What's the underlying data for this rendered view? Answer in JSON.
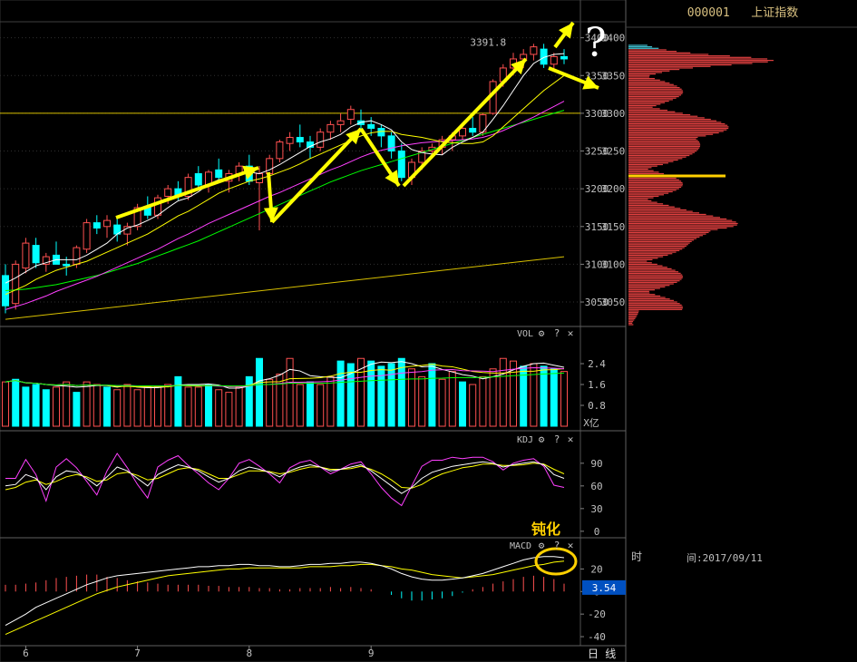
{
  "header": {
    "code": "000001",
    "name": "上证指数"
  },
  "footer": {
    "period": "日 线"
  },
  "time_panel": {
    "label_a": "时",
    "label_b": "间:2017/09/11"
  },
  "annotations": {
    "question": "?",
    "blunt": "钝化"
  },
  "colors": {
    "up": "#ff5050",
    "down": "#00ffff",
    "ma5": "#ffffff",
    "ma10": "#ffff00",
    "ma20": "#ff40ff",
    "ma60": "#00ff00",
    "arrow": "#ffff00",
    "profile": "#e04040"
  },
  "chart_data": [
    {
      "type": "candlestick",
      "name": "price",
      "ylim": [
        3020,
        3420
      ],
      "yticks": [
        3050,
        3100,
        3150,
        3200,
        3250,
        3300,
        3350,
        3400
      ],
      "month_ticks": [
        {
          "label": "6",
          "index": 2
        },
        {
          "label": "7",
          "index": 13
        },
        {
          "label": "8",
          "index": 24
        },
        {
          "label": "9",
          "index": 36
        }
      ],
      "max_label": "3391.8",
      "ohlc": [
        [
          3085,
          3100,
          3035,
          3045
        ],
        [
          3048,
          3105,
          3040,
          3100
        ],
        [
          3095,
          3135,
          3088,
          3128
        ],
        [
          3125,
          3135,
          3095,
          3102
        ],
        [
          3100,
          3115,
          3090,
          3110
        ],
        [
          3112,
          3130,
          3100,
          3100
        ],
        [
          3100,
          3110,
          3085,
          3098
        ],
        [
          3100,
          3125,
          3095,
          3122
        ],
        [
          3120,
          3160,
          3115,
          3155
        ],
        [
          3155,
          3165,
          3140,
          3148
        ],
        [
          3150,
          3165,
          3135,
          3158
        ],
        [
          3152,
          3160,
          3130,
          3140
        ],
        [
          3140,
          3155,
          3125,
          3150
        ],
        [
          3150,
          3180,
          3145,
          3175
        ],
        [
          3175,
          3190,
          3160,
          3165
        ],
        [
          3165,
          3192,
          3160,
          3188
        ],
        [
          3190,
          3205,
          3180,
          3200
        ],
        [
          3200,
          3210,
          3185,
          3190
        ],
        [
          3190,
          3220,
          3185,
          3215
        ],
        [
          3220,
          3230,
          3200,
          3205
        ],
        [
          3205,
          3225,
          3195,
          3222
        ],
        [
          3225,
          3240,
          3210,
          3215
        ],
        [
          3210,
          3225,
          3195,
          3220
        ],
        [
          3220,
          3235,
          3210,
          3230
        ],
        [
          3230,
          3245,
          3205,
          3210
        ],
        [
          3208,
          3230,
          3145,
          3220
        ],
        [
          3220,
          3245,
          3215,
          3240
        ],
        [
          3240,
          3265,
          3235,
          3262
        ],
        [
          3260,
          3275,
          3250,
          3268
        ],
        [
          3268,
          3285,
          3255,
          3262
        ],
        [
          3262,
          3270,
          3240,
          3255
        ],
        [
          3255,
          3280,
          3250,
          3275
        ],
        [
          3275,
          3290,
          3265,
          3285
        ],
        [
          3285,
          3300,
          3275,
          3290
        ],
        [
          3292,
          3310,
          3285,
          3305
        ],
        [
          3290,
          3305,
          3275,
          3285
        ],
        [
          3285,
          3295,
          3270,
          3280
        ],
        [
          3280,
          3285,
          3255,
          3270
        ],
        [
          3270,
          3275,
          3240,
          3250
        ],
        [
          3250,
          3260,
          3210,
          3215
        ],
        [
          3215,
          3240,
          3205,
          3235
        ],
        [
          3235,
          3255,
          3225,
          3250
        ],
        [
          3250,
          3260,
          3240,
          3255
        ],
        [
          3255,
          3270,
          3245,
          3265
        ],
        [
          3265,
          3275,
          3250,
          3270
        ],
        [
          3270,
          3285,
          3265,
          3280
        ],
        [
          3280,
          3295,
          3270,
          3275
        ],
        [
          3275,
          3300,
          3270,
          3298
        ],
        [
          3300,
          3345,
          3298,
          3342
        ],
        [
          3342,
          3365,
          3335,
          3360
        ],
        [
          3360,
          3380,
          3350,
          3372
        ],
        [
          3372,
          3385,
          3360,
          3378
        ],
        [
          3378,
          3392,
          3370,
          3388
        ],
        [
          3385,
          3392,
          3360,
          3365
        ],
        [
          3365,
          3380,
          3355,
          3375
        ],
        [
          3375,
          3385,
          3365,
          3372
        ]
      ],
      "ma5": [
        3075,
        3082,
        3090,
        3098,
        3102,
        3106,
        3106,
        3106,
        3112,
        3120,
        3128,
        3140,
        3148,
        3152,
        3158,
        3165,
        3175,
        3184,
        3188,
        3196,
        3206,
        3212,
        3215,
        3218,
        3222,
        3220,
        3225,
        3232,
        3240,
        3248,
        3256,
        3262,
        3266,
        3272,
        3282,
        3288,
        3290,
        3285,
        3278,
        3262,
        3252,
        3248,
        3246,
        3245,
        3255,
        3262,
        3268,
        3275,
        3292,
        3310,
        3330,
        3350,
        3366,
        3374,
        3378,
        3379
      ],
      "ma10": [
        3060,
        3066,
        3072,
        3080,
        3086,
        3092,
        3096,
        3100,
        3104,
        3110,
        3116,
        3122,
        3128,
        3134,
        3140,
        3148,
        3156,
        3164,
        3170,
        3178,
        3186,
        3194,
        3200,
        3205,
        3210,
        3213,
        3217,
        3222,
        3227,
        3233,
        3240,
        3246,
        3252,
        3258,
        3264,
        3270,
        3274,
        3276,
        3276,
        3272,
        3270,
        3268,
        3265,
        3262,
        3261,
        3260,
        3260,
        3262,
        3270,
        3282,
        3294,
        3306,
        3318,
        3330,
        3340,
        3350
      ],
      "ma20": [
        3040,
        3044,
        3048,
        3053,
        3058,
        3064,
        3069,
        3074,
        3079,
        3084,
        3090,
        3096,
        3102,
        3108,
        3114,
        3120,
        3127,
        3134,
        3140,
        3147,
        3154,
        3160,
        3166,
        3172,
        3178,
        3184,
        3190,
        3195,
        3201,
        3207,
        3213,
        3219,
        3225,
        3230,
        3236,
        3242,
        3247,
        3251,
        3254,
        3257,
        3259,
        3261,
        3262,
        3263,
        3264,
        3265,
        3266,
        3268,
        3272,
        3277,
        3283,
        3289,
        3295,
        3302,
        3309,
        3316
      ],
      "ma60": [
        3065,
        3066,
        3067,
        3069,
        3071,
        3073,
        3076,
        3079,
        3082,
        3085,
        3089,
        3093,
        3097,
        3101,
        3106,
        3111,
        3116,
        3121,
        3126,
        3131,
        3137,
        3143,
        3149,
        3155,
        3161,
        3167,
        3173,
        3179,
        3185,
        3191,
        3197,
        3203,
        3209,
        3214,
        3219,
        3224,
        3228,
        3232,
        3236,
        3240,
        3244,
        3248,
        3252,
        3256,
        3260,
        3264,
        3268,
        3272,
        3276,
        3280,
        3284,
        3288,
        3292,
        3296,
        3300,
        3304
      ],
      "hlines": [
        3300
      ],
      "trend_line": {
        "x": [
          0,
          55
        ],
        "y": [
          3027,
          3110
        ]
      }
    },
    {
      "type": "bar",
      "name": "VOL",
      "unit": "X亿",
      "ylim": [
        0,
        3.2
      ],
      "yticks": [
        0.8,
        1.6,
        2.4
      ],
      "values": [
        1.7,
        1.8,
        1.5,
        1.6,
        1.4,
        1.5,
        1.7,
        1.3,
        1.7,
        1.6,
        1.5,
        1.4,
        1.6,
        1.4,
        1.5,
        1.5,
        1.6,
        1.9,
        1.5,
        1.5,
        1.6,
        1.4,
        1.3,
        1.5,
        1.9,
        2.6,
        1.8,
        2.0,
        2.6,
        1.6,
        1.7,
        1.6,
        1.9,
        2.5,
        2.4,
        2.6,
        2.5,
        2.3,
        2.4,
        2.6,
        2.2,
        1.9,
        2.4,
        1.8,
        2.1,
        1.7,
        1.6,
        1.9,
        2.2,
        2.6,
        2.5,
        2.3,
        2.4,
        2.3,
        2.2,
        2.1
      ],
      "down": [
        false,
        true,
        true,
        true,
        true,
        false,
        false,
        true,
        false,
        false,
        true,
        false,
        false,
        false,
        false,
        false,
        false,
        true,
        false,
        false,
        true,
        false,
        false,
        false,
        true,
        true,
        false,
        false,
        false,
        false,
        true,
        false,
        false,
        true,
        true,
        false,
        true,
        true,
        true,
        true,
        false,
        false,
        true,
        false,
        false,
        true,
        false,
        false,
        false,
        false,
        false,
        true,
        false,
        true,
        true,
        false
      ]
    },
    {
      "type": "line",
      "name": "KDJ",
      "ylim": [
        -5,
        115
      ],
      "yticks": [
        0,
        30,
        60,
        90
      ],
      "K": [
        60,
        62,
        75,
        70,
        55,
        72,
        80,
        78,
        70,
        60,
        72,
        85,
        80,
        70,
        60,
        75,
        82,
        88,
        85,
        80,
        72,
        65,
        70,
        80,
        85,
        82,
        78,
        72,
        80,
        85,
        88,
        85,
        80,
        82,
        85,
        88,
        80,
        70,
        60,
        50,
        58,
        70,
        78,
        82,
        86,
        88,
        90,
        92,
        90,
        85,
        88,
        90,
        92,
        88,
        75,
        70
      ],
      "D": [
        55,
        58,
        65,
        68,
        62,
        66,
        72,
        75,
        72,
        66,
        68,
        76,
        78,
        74,
        68,
        70,
        76,
        82,
        84,
        82,
        76,
        70,
        70,
        75,
        80,
        80,
        79,
        76,
        78,
        82,
        85,
        85,
        82,
        82,
        83,
        86,
        82,
        76,
        68,
        58,
        57,
        62,
        70,
        76,
        80,
        84,
        86,
        89,
        89,
        87,
        87,
        88,
        90,
        89,
        82,
        76
      ],
      "J": [
        70,
        70,
        95,
        75,
        40,
        85,
        96,
        84,
        66,
        48,
        80,
        103,
        84,
        62,
        44,
        85,
        94,
        100,
        87,
        76,
        64,
        55,
        70,
        90,
        95,
        86,
        76,
        64,
        84,
        91,
        94,
        85,
        76,
        82,
        89,
        92,
        76,
        58,
        44,
        34,
        60,
        86,
        94,
        94,
        98,
        96,
        98,
        98,
        92,
        81,
        90,
        94,
        96,
        86,
        61,
        58
      ]
    },
    {
      "type": "line",
      "name": "MACD",
      "ylim": [
        -48,
        38
      ],
      "yticks": [
        -40,
        -20,
        0,
        20
      ],
      "current_value": "3.54",
      "dif": [
        -30,
        -25,
        -20,
        -14,
        -10,
        -6,
        -2,
        2,
        6,
        9,
        12,
        14,
        15,
        16,
        17,
        18,
        19,
        20,
        21,
        22,
        22,
        23,
        23,
        24,
        24,
        23,
        23,
        22,
        22,
        23,
        24,
        24,
        25,
        25,
        26,
        26,
        25,
        23,
        20,
        16,
        13,
        11,
        10,
        10,
        11,
        12,
        14,
        16,
        19,
        22,
        25,
        28,
        30,
        31,
        31,
        30
      ],
      "dea": [
        -38,
        -34,
        -30,
        -26,
        -22,
        -18,
        -14,
        -10,
        -6,
        -2,
        1,
        4,
        6,
        8,
        10,
        12,
        14,
        15,
        16,
        17,
        18,
        19,
        20,
        20,
        21,
        21,
        21,
        21,
        21,
        21,
        22,
        22,
        22,
        23,
        23,
        24,
        24,
        23,
        22,
        20,
        19,
        17,
        15,
        14,
        13,
        12,
        13,
        14,
        15,
        17,
        19,
        21,
        23,
        24,
        26,
        27
      ],
      "hist": [
        6,
        6,
        7,
        8,
        10,
        12,
        13,
        14,
        15,
        15,
        13,
        12,
        10,
        9,
        8,
        7,
        6,
        6,
        6,
        6,
        5,
        5,
        4,
        4,
        4,
        3,
        3,
        2,
        2,
        3,
        3,
        3,
        4,
        3,
        4,
        3,
        2,
        0,
        -3,
        -6,
        -8,
        -8,
        -7,
        -6,
        -4,
        -1,
        2,
        4,
        7,
        9,
        11,
        13,
        14,
        13,
        11,
        7
      ]
    }
  ]
}
